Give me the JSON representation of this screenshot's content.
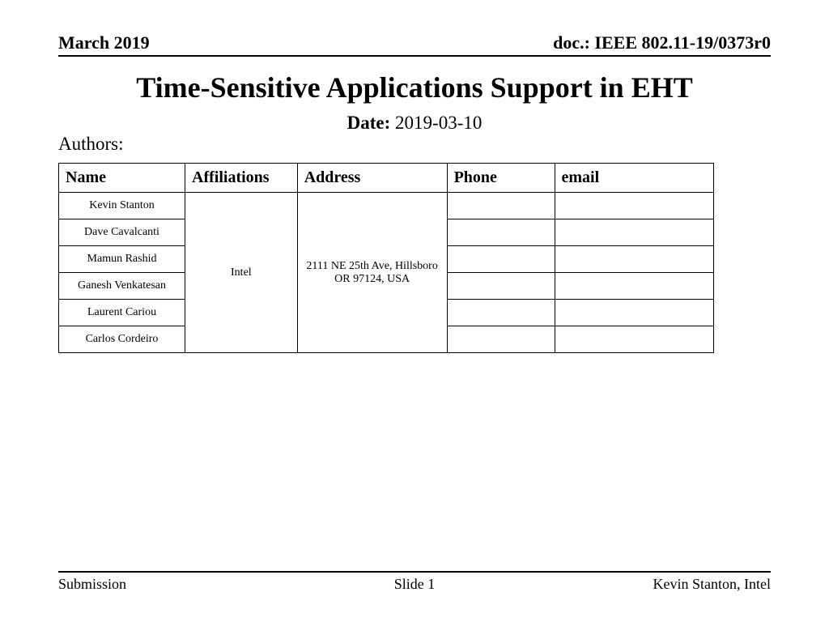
{
  "header": {
    "left": "March 2019",
    "right": "doc.: IEEE 802.11-19/0373r0"
  },
  "title": "Time-Sensitive Applications Support in EHT",
  "date": {
    "label": "Date:",
    "value": "2019-03-10"
  },
  "authors_label": "Authors:",
  "table": {
    "headers": {
      "name": "Name",
      "affiliations": "Affiliations",
      "address": "Address",
      "phone": "Phone",
      "email": "email"
    },
    "affiliation": "Intel",
    "address": "2111 NE 25th Ave, Hillsboro OR 97124, USA",
    "names": [
      "Kevin Stanton",
      "Dave Cavalcanti",
      "Mamun Rashid",
      "Ganesh Venkatesan",
      "Laurent Cariou",
      "Carlos Cordeiro"
    ]
  },
  "footer": {
    "left": "Submission",
    "center": "Slide 1",
    "right": "Kevin Stanton, Intel"
  }
}
